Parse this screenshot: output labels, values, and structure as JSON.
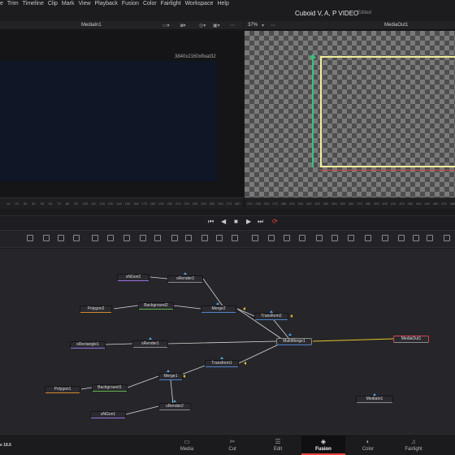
{
  "menu": [
    "e",
    "Trim",
    "Timeline",
    "Clip",
    "Mark",
    "View",
    "Playback",
    "Fusion",
    "Color",
    "Fairlight",
    "Workspace",
    "Help"
  ],
  "project": {
    "title": "Cuboid V, A, P VIDEO",
    "status": "Edited"
  },
  "viewer_left": {
    "title": "MediaIn1",
    "resolution": "3840x2160xfloat32"
  },
  "viewer_right": {
    "title": "MediaOut1",
    "zoom": "37%"
  },
  "ruler_left": [
    "10",
    "20",
    "30",
    "40",
    "50",
    "60",
    "70",
    "80",
    "90",
    "100",
    "110",
    "120",
    "130",
    "140",
    "150",
    "160",
    "170",
    "180",
    "190",
    "200",
    "210",
    "220",
    "230",
    "240",
    "250",
    "260",
    "270",
    "280"
  ],
  "ruler_right": [
    "240",
    "250",
    "260",
    "270",
    "280",
    "290",
    "300",
    "310",
    "320",
    "330",
    "340",
    "350",
    "360",
    "370",
    "380",
    "390",
    "400",
    "410",
    "420",
    "430",
    "440",
    "450",
    "460",
    "470",
    "480"
  ],
  "transport": {
    "first": "⏮",
    "prev": "◀",
    "stop": "■",
    "play": "▶",
    "last": "⏭",
    "loop": "⟳"
  },
  "nodes": {
    "sngon2": "sNGon2",
    "srender3": "sRender3",
    "polygon2": "Polygon2",
    "background2": "Background2",
    "merge2": "Merge2",
    "transform2": "Transform2",
    "srectangle1": "sRectangle1",
    "srender1": "sRender1",
    "multimerge1": "MultiMerge1",
    "mediaout1": "MediaOut1",
    "transform1": "Transform1",
    "merge1": "Merge1",
    "polygon1": "Polygon1",
    "background1": "Background1",
    "srender2": "sRender2",
    "sngon1": "sNGon1",
    "mediain1": "MediaIn1"
  },
  "pages": [
    {
      "label": "Media",
      "icon": "▭"
    },
    {
      "label": "Cut",
      "icon": "✂"
    },
    {
      "label": "Edit",
      "icon": "☰"
    },
    {
      "label": "Fusion",
      "icon": "◈"
    },
    {
      "label": "Color",
      "icon": "◐"
    },
    {
      "label": "Fairlight",
      "icon": "♫"
    }
  ],
  "version": "e 18.6",
  "colors": {
    "accent": "#e3443a",
    "selection": "#f2ef9c",
    "link": "#e4c22a"
  }
}
